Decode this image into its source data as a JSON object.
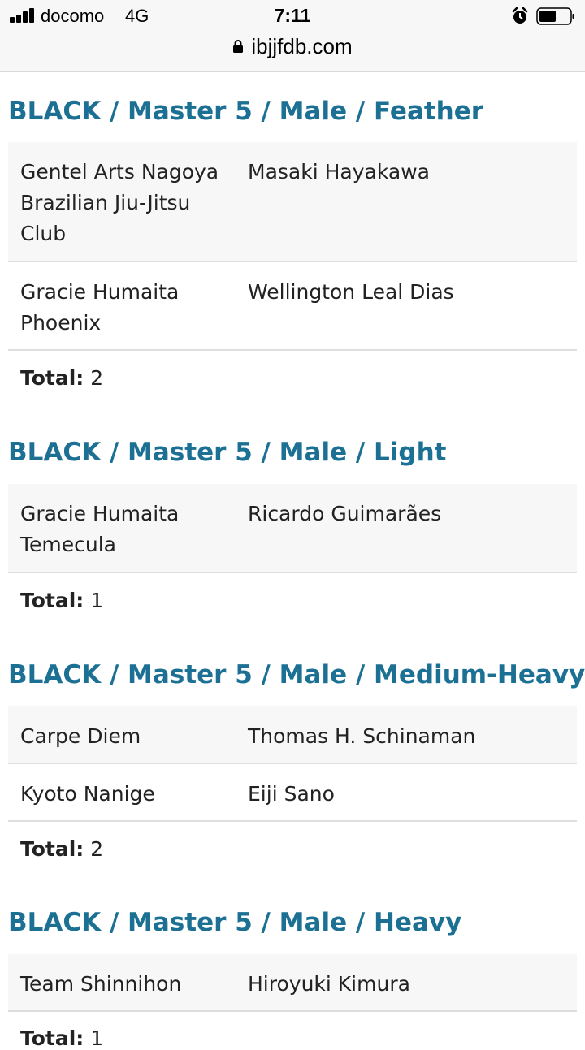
{
  "status_bar": {
    "carrier": "docomo",
    "network": "4G",
    "time": "7:11",
    "url": "ibjjfdb.com",
    "icons": [
      "signal-icon",
      "alarm-icon",
      "battery-icon",
      "lock-icon"
    ]
  },
  "colors": {
    "heading": "#1b7093",
    "row_shade": "#f7f7f7",
    "divider": "#dedede"
  },
  "sections": [
    {
      "title": "BLACK / Master 5 / Male / Feather",
      "rows": [
        {
          "team": "Gentel Arts Nagoya Brazilian Jiu-Jitsu Club",
          "athlete": "Masaki Hayakawa"
        },
        {
          "team": "Gracie Humaita Phoenix",
          "athlete": "Wellington Leal Dias"
        }
      ],
      "total_label": "Total:",
      "total_value": "2"
    },
    {
      "title": "BLACK / Master 5 / Male / Light",
      "rows": [
        {
          "team": "Gracie Humaita Temecula",
          "athlete": "Ricardo Guimarães"
        }
      ],
      "total_label": "Total:",
      "total_value": "1"
    },
    {
      "title": "BLACK / Master 5 / Male / Medium-Heavy",
      "rows": [
        {
          "team": "Carpe Diem",
          "athlete": "Thomas H. Schinaman"
        },
        {
          "team": "Kyoto Nanige",
          "athlete": "Eiji Sano"
        }
      ],
      "total_label": "Total:",
      "total_value": "2"
    },
    {
      "title": "BLACK / Master 5 / Male / Heavy",
      "rows": [
        {
          "team": "Team Shinnihon",
          "athlete": "Hiroyuki Kimura"
        }
      ],
      "total_label": "Total:",
      "total_value": "1"
    }
  ]
}
